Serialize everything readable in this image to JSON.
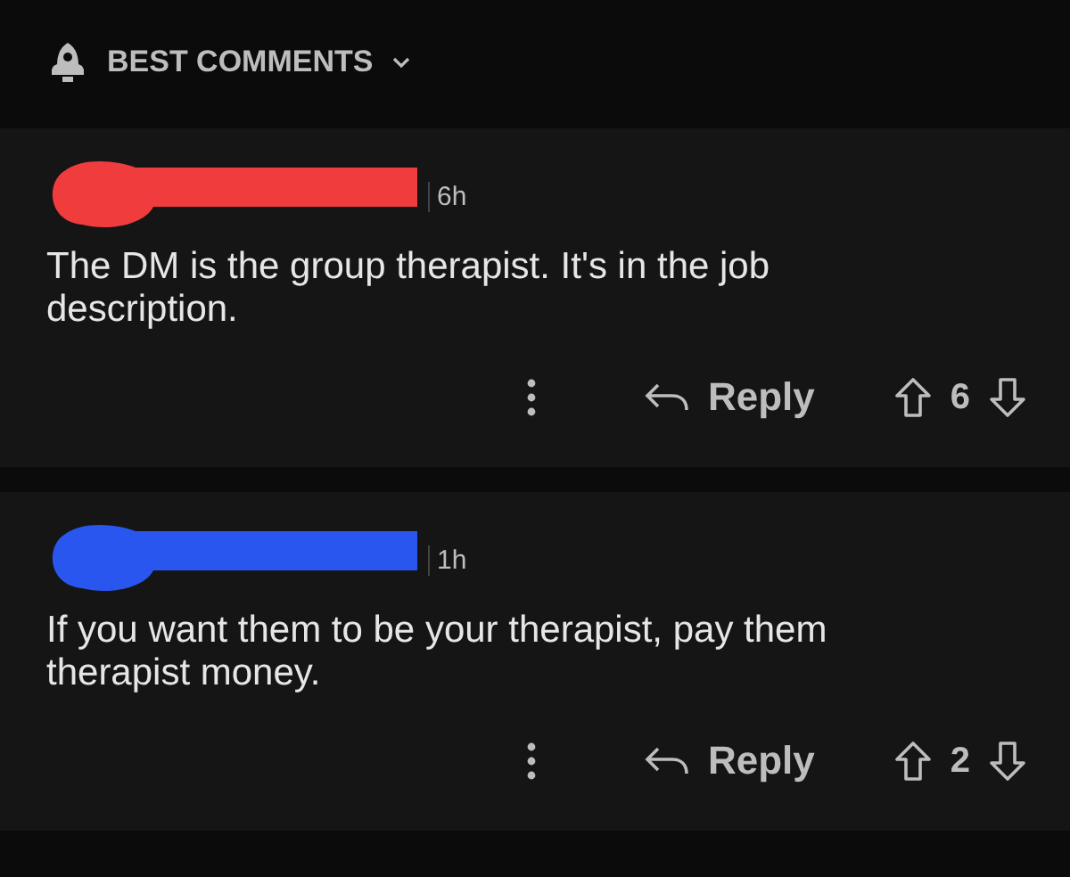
{
  "sort": {
    "label": "BEST COMMENTS"
  },
  "comments": [
    {
      "color": "#f03c3c",
      "time": "6h",
      "body": "The DM is the group therapist. It's in the job description.",
      "reply": "Reply",
      "score": "6"
    },
    {
      "color": "#2a56f0",
      "time": "1h",
      "body": "If you want them to be your therapist, pay them therapist money.",
      "reply": "Reply",
      "score": "2"
    }
  ]
}
